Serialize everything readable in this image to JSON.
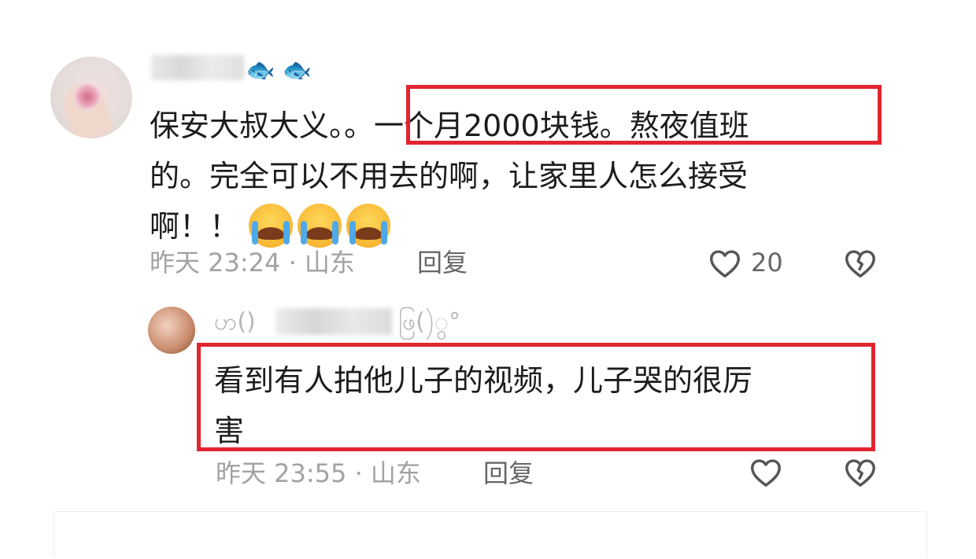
{
  "comment": {
    "username_suffix": "🐟 🐟",
    "text": "保安大叔大义。。一个月2000块钱。熬夜值班的。完全可以不用去的啊，让家里人怎么接受啊！！",
    "text_line1": "保安大叔大义。。一个月2000块钱。熬夜值班",
    "text_line2": "的。完全可以不用去的啊，让家里人怎么接受",
    "text_line3": "啊！！",
    "emojis": [
      "loudly-crying-face",
      "loudly-crying-face",
      "loudly-crying-face"
    ],
    "time": "昨天 23:24 · 山东",
    "reply_label": "回复",
    "like_count": "20"
  },
  "reply": {
    "username_prefix": "ဟ()",
    "username_suffix": "ဖြ()ွ°",
    "text_line1": "看到有人拍他儿子的视频，儿子哭的很厉",
    "text_line2": "害",
    "time": "昨天 23:55 · 山东",
    "reply_label": "回复"
  },
  "icons": {
    "like": "heart-outline-icon",
    "dislike": "broken-heart-icon"
  },
  "colors": {
    "highlight": "#e1252f",
    "meta_text": "#a2a2a2",
    "body_text": "#1c1c1c"
  }
}
